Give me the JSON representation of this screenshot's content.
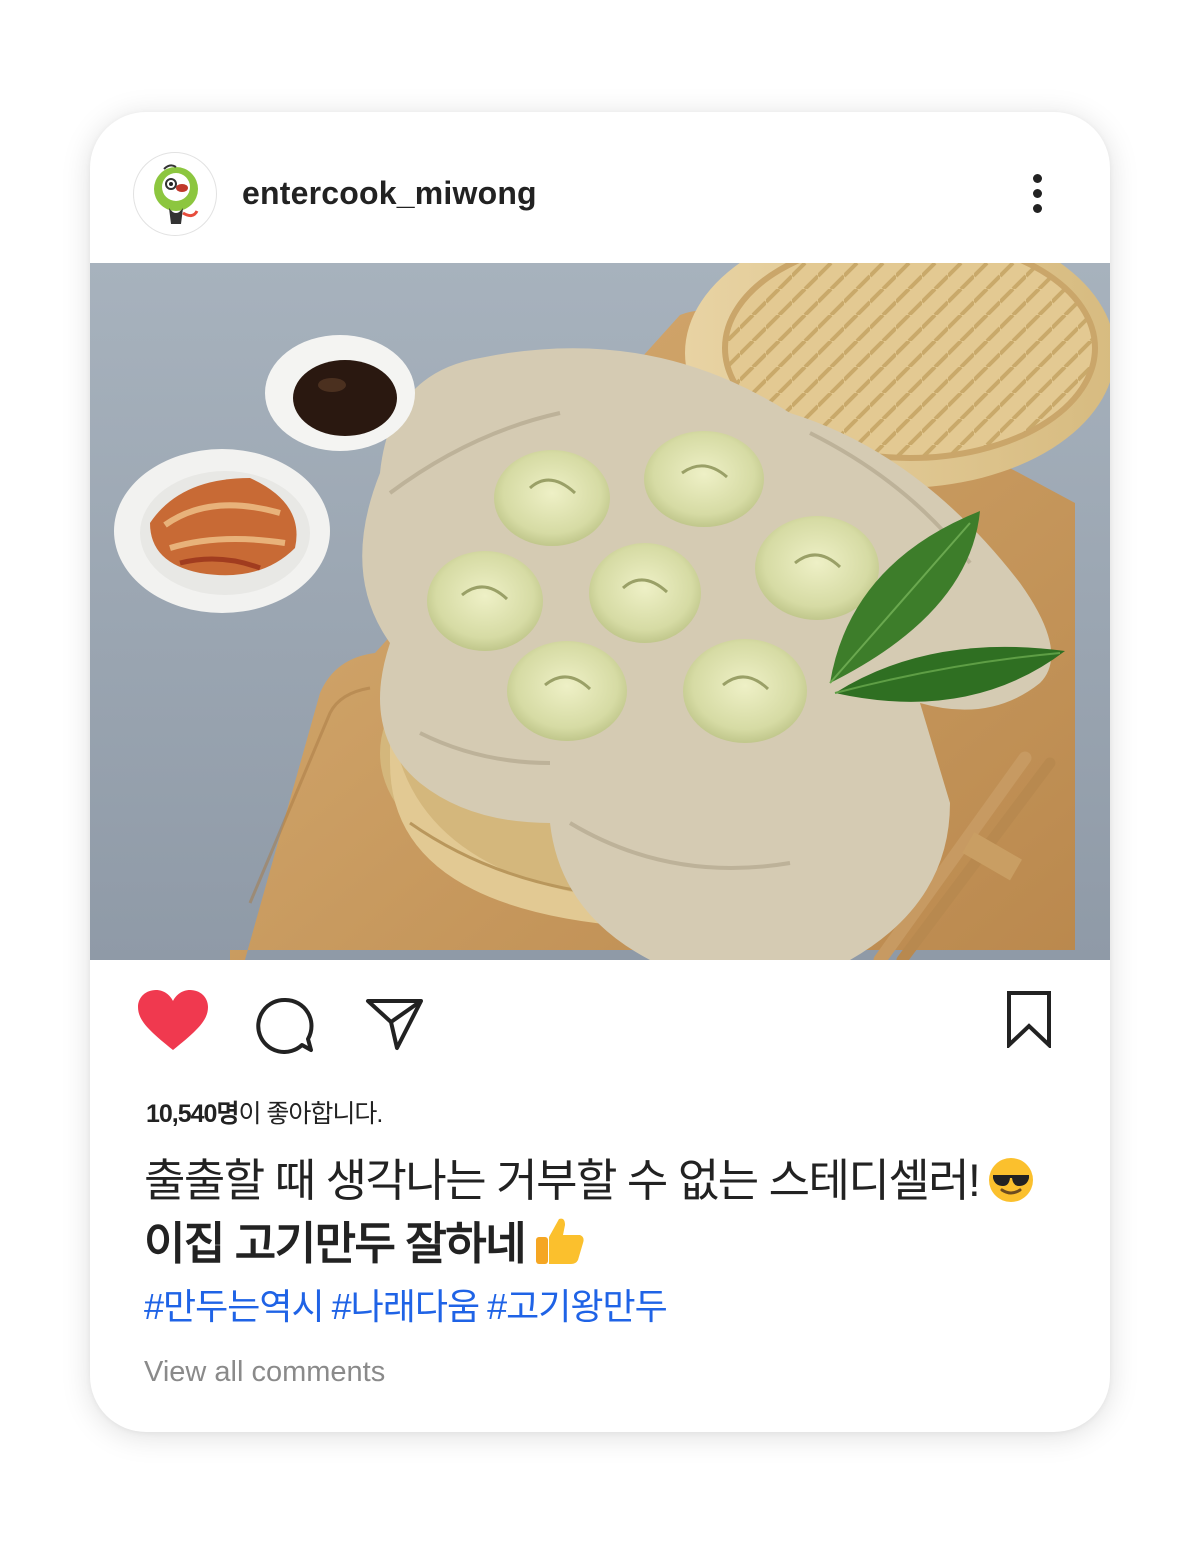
{
  "post": {
    "username": "entercook_miwong",
    "likes_count": "10,540명",
    "likes_suffix": "이 좋아합니다.",
    "caption_line1": "출출할 때 생각나는 거부할 수 없는 스테디셀러!",
    "caption_line1_emoji": "smiling-face-with-sunglasses-emoji",
    "caption_line2": "이집 고기만두 잘하네",
    "caption_line2_emoji": "thumbs-up-emoji",
    "hashtags": [
      "#만두는역시",
      "#나래다움",
      "#고기왕만두"
    ],
    "view_all_comments": "View all comments",
    "liked": true
  },
  "icons": {
    "more": "vertical-ellipsis-icon",
    "like": "heart-icon",
    "comment": "comment-bubble-icon",
    "share": "paper-plane-icon",
    "save": "bookmark-icon"
  },
  "colors": {
    "heart": "#f0394f",
    "hashtag": "#1f63e6",
    "text": "#222222",
    "muted": "#8a8a8a",
    "avatar_accent": "#8cc63f"
  }
}
